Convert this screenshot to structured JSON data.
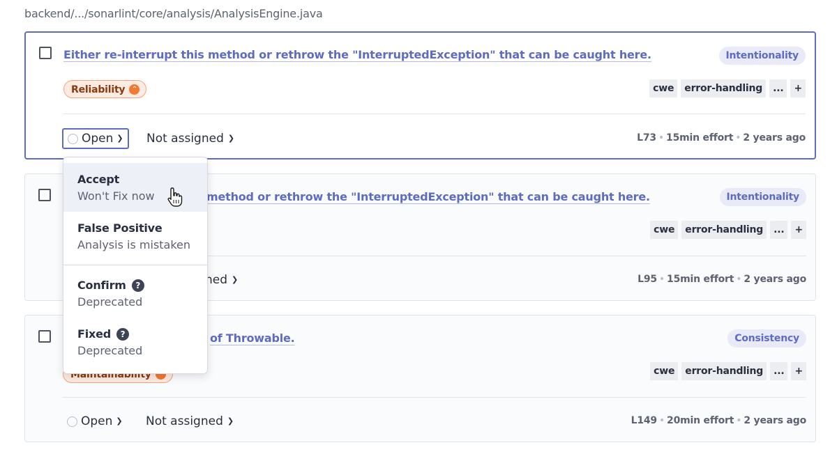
{
  "breadcrumb": "backend/.../sonarlint/core/analysis/AnalysisEngine.java",
  "issues": [
    {
      "title": "Either re-interrupt this method or rethrow the \"InterruptedException\" that can be caught here.",
      "attribute": "Intentionality",
      "impact": "Reliability",
      "tags": [
        "cwe",
        "error-handling",
        "...",
        "+"
      ],
      "status": "Open",
      "assignee": "Not assigned",
      "line": "L73",
      "effort": "15min effort",
      "age": "2 years ago"
    },
    {
      "title": "Either re-interrupt this method or rethrow the \"InterruptedException\" that can be caught here.",
      "title_visible": "method or rethrow the \"InterruptedException\" that can be caught here.",
      "attribute": "Intentionality",
      "tags": [
        "cwe",
        "error-handling",
        "...",
        "+"
      ],
      "assignee_visible": "ned",
      "line": "L95",
      "effort": "15min effort",
      "age": "2 years ago"
    },
    {
      "title_visible": "of Throwable.",
      "attribute": "Consistency",
      "impact": "Maintainability",
      "tags": [
        "cwe",
        "error-handling",
        "...",
        "+"
      ],
      "status": "Open",
      "assignee": "Not assigned",
      "line": "L149",
      "effort": "20min effort",
      "age": "2 years ago"
    }
  ],
  "status_menu": {
    "items": [
      {
        "title": "Accept",
        "subtitle": "Won't Fix now"
      },
      {
        "title": "False Positive",
        "subtitle": "Analysis is mistaken"
      },
      {
        "title": "Confirm",
        "subtitle": "Deprecated",
        "help": "?"
      },
      {
        "title": "Fixed",
        "subtitle": "Deprecated",
        "help": "?"
      }
    ]
  },
  "colors": {
    "accent": "#5d6cc0",
    "reliability_badge": "#fdebe1",
    "severity": "#f07a32"
  },
  "icons": [
    "checkbox-icon",
    "status-circle-icon",
    "chevron-down-icon",
    "severity-high-icon",
    "help-icon",
    "hand-cursor-icon"
  ]
}
